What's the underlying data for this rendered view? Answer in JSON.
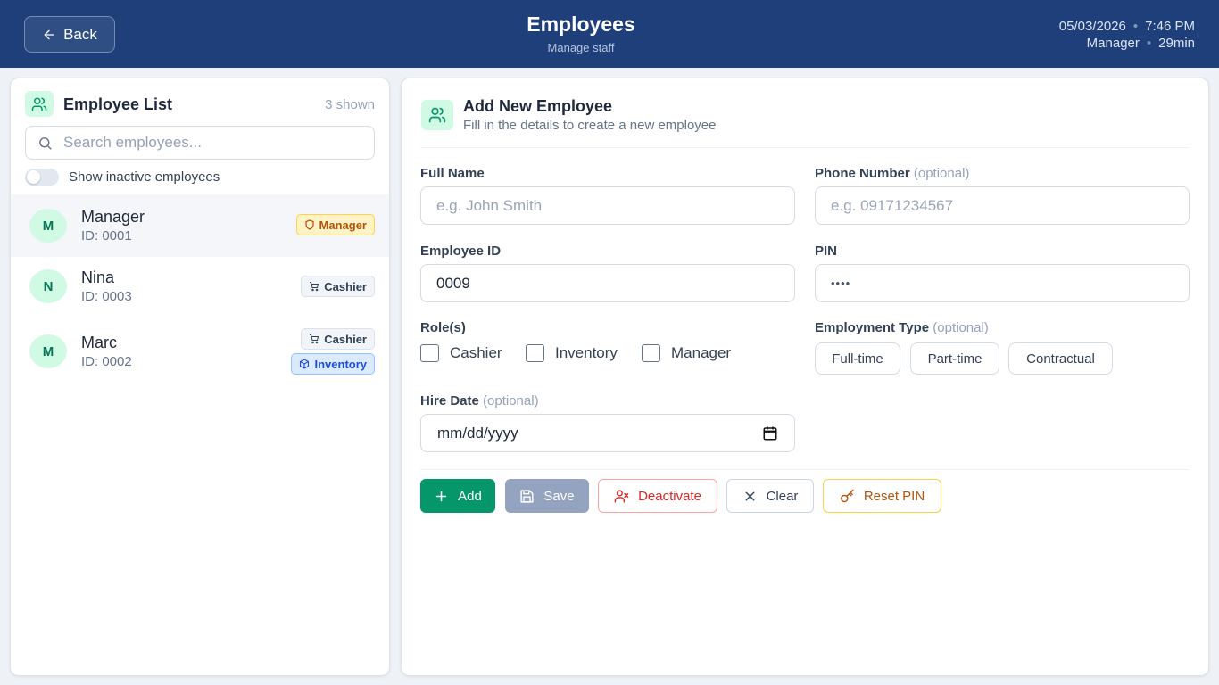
{
  "header": {
    "back_label": "Back",
    "title": "Employees",
    "subtitle": "Manage staff",
    "date": "05/03/2026",
    "time": "7:46 PM",
    "user": "Manager",
    "session": "29min"
  },
  "employee_list": {
    "title": "Employee List",
    "count": "3 shown",
    "search_placeholder": "Search employees...",
    "toggle_label": "Show inactive employees",
    "toggle_on": false,
    "employees": [
      {
        "initial": "M",
        "name": "Manager",
        "id": "ID: 0001",
        "selected": true,
        "roles": [
          {
            "label": "Manager",
            "kind": "manager",
            "icon": "shield-icon"
          }
        ]
      },
      {
        "initial": "N",
        "name": "Nina",
        "id": "ID: 0003",
        "selected": false,
        "roles": [
          {
            "label": "Cashier",
            "kind": "cashier",
            "icon": "cart-icon"
          }
        ]
      },
      {
        "initial": "M",
        "name": "Marc",
        "id": "ID: 0002",
        "selected": false,
        "roles": [
          {
            "label": "Cashier",
            "kind": "cashier",
            "icon": "cart-icon"
          },
          {
            "label": "Inventory",
            "kind": "inventory",
            "icon": "box-icon"
          }
        ]
      }
    ]
  },
  "form": {
    "title": "Add New Employee",
    "subtitle": "Fill in the details to create a new employee",
    "full_name_label": "Full Name",
    "full_name_placeholder": "e.g. John Smith",
    "full_name_value": "",
    "phone_label": "Phone Number",
    "phone_optional": "(optional)",
    "phone_placeholder": "e.g. 09171234567",
    "employee_id_label": "Employee ID",
    "employee_id_value": "0009",
    "pin_label": "PIN",
    "pin_value": "••••",
    "roles_label": "Role(s)",
    "roles": [
      "Cashier",
      "Inventory",
      "Manager"
    ],
    "employment_type_label": "Employment Type",
    "employment_type_optional": "(optional)",
    "employment_types": [
      "Full-time",
      "Part-time",
      "Contractual"
    ],
    "hire_date_label": "Hire Date",
    "hire_date_optional": "(optional)",
    "hire_date_placeholder": "mm/dd/yyyy"
  },
  "actions": {
    "add": "Add",
    "save": "Save",
    "deactivate": "Deactivate",
    "clear": "Clear",
    "reset_pin": "Reset PIN"
  },
  "colors": {
    "header_bg": "#1e3f7a",
    "accent_green": "#059669",
    "danger": "#dc2626",
    "warning": "#b45309",
    "info": "#1d4ed8"
  }
}
